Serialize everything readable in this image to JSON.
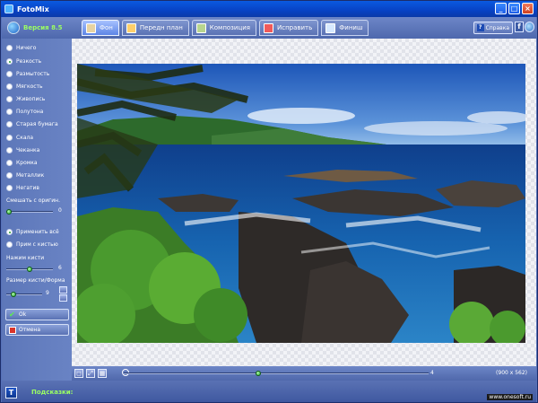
{
  "window": {
    "title": "FotoMix",
    "minimize": "_",
    "maximize": "□",
    "close": "×"
  },
  "header": {
    "version": "Версия 8.5",
    "tabs": [
      {
        "label": "Фон",
        "icon": "background-icon",
        "active": true
      },
      {
        "label": "Передн план",
        "icon": "foreground-icon",
        "active": false
      },
      {
        "label": "Композиция",
        "icon": "composition-icon",
        "active": false
      },
      {
        "label": "Исправить",
        "icon": "fix-icon",
        "active": false
      },
      {
        "label": "Финиш",
        "icon": "finish-icon",
        "active": false
      }
    ],
    "help_label": "Справка",
    "help_q": "?",
    "facebook": "f"
  },
  "sidebar": {
    "effects": [
      {
        "label": "Ничего",
        "selected": false
      },
      {
        "label": "Резкость",
        "selected": true
      },
      {
        "label": "Размытость",
        "selected": false
      },
      {
        "label": "Мягкость",
        "selected": false
      },
      {
        "label": "Живопись",
        "selected": false
      },
      {
        "label": "Полутона",
        "selected": false
      },
      {
        "label": "Старая бумага",
        "selected": false
      },
      {
        "label": "Скала",
        "selected": false
      },
      {
        "label": "Чеканка",
        "selected": false
      },
      {
        "label": "Кромка",
        "selected": false
      },
      {
        "label": "Металлик",
        "selected": false
      },
      {
        "label": "Негатив",
        "selected": false
      }
    ],
    "mix_label": "Смешать с оригин.",
    "mix_value": "0",
    "mix_level": 0.0,
    "apply_all": "Применить всё",
    "apply_brush": "Прим с кистью",
    "brush_pressure_label": "Нажим кисти",
    "brush_pressure_value": "6",
    "brush_pressure_level": 0.5,
    "brush_size_label": "Размер кисти/Форма",
    "brush_size_value": "9",
    "brush_size_level": 0.15,
    "ok_label": "Ok",
    "cancel_label": "Отмена"
  },
  "bottom": {
    "zoom_value": "4",
    "zoom_level": 0.44,
    "dimensions": "(900 x 562)"
  },
  "status": {
    "tips_icon": "T",
    "tips_label": "Подсказки:",
    "watermark": "www.onesoft.ru"
  },
  "colors": {
    "accent_green": "#9bff62",
    "panel": "#5671b8",
    "titlebar": "#0842c4"
  }
}
